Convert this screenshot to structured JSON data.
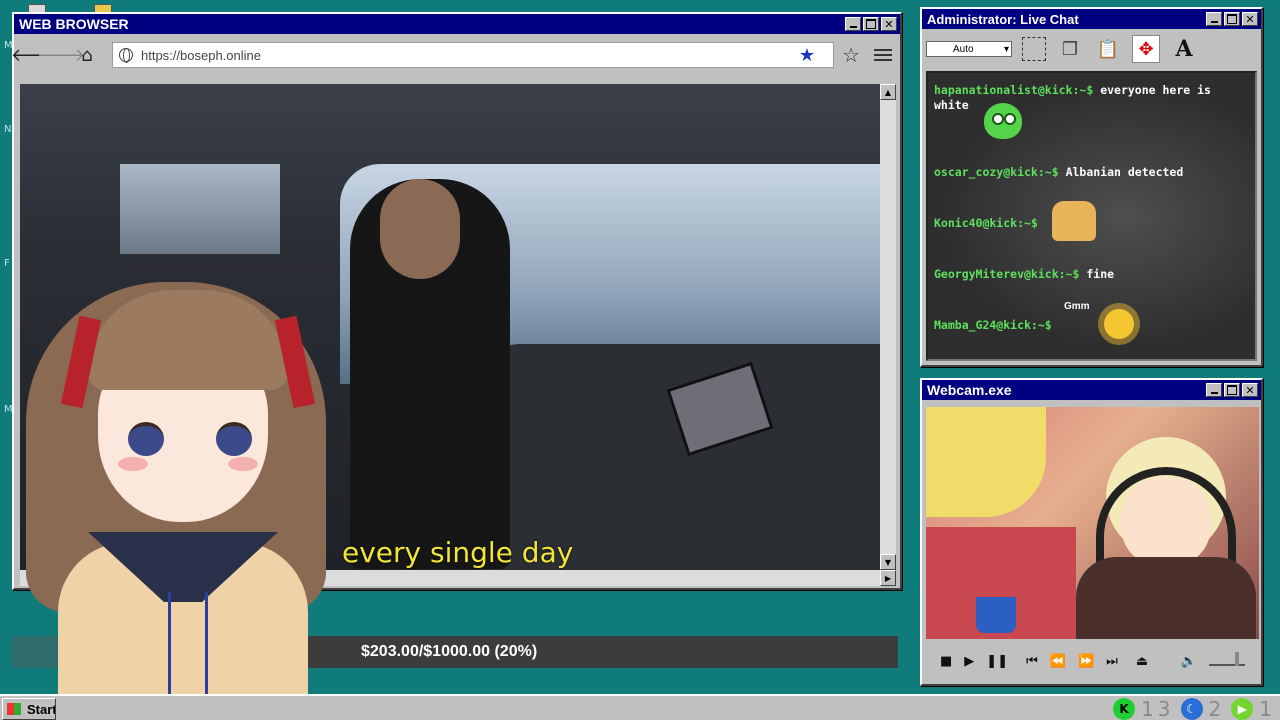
{
  "browser": {
    "title": "WEB BROWSER",
    "url": "https://boseph.online",
    "video_caption": "every single day"
  },
  "chat": {
    "title": "Administrator: Live Chat",
    "zoom_select": "Auto",
    "messages": [
      {
        "user": "hapanationalist@kick:~$",
        "text": "everyone here is",
        "text2": "white",
        "emote": "green-blob-emote"
      },
      {
        "user": "oscar_cozy@kick:~$",
        "text": "Albanian detected"
      },
      {
        "user": "Konic40@kick:~$",
        "text": "",
        "emote": "eevee-emote"
      },
      {
        "user": "GeorgyMiterev@kick:~$",
        "text": "fine"
      },
      {
        "user": "Mamba_G24@kick:~$",
        "text": "",
        "emote": "sun-emote",
        "emote_label": "Gmm"
      }
    ]
  },
  "webcam": {
    "title": "Webcam.exe"
  },
  "donation": {
    "label": "$203.00/$1000.00 (20%)",
    "raised": 203.0,
    "goal": 1000.0,
    "percent": 20
  },
  "taskbar": {
    "start_label": "Start",
    "tray": [
      {
        "icon": "kick-icon",
        "count": "13"
      },
      {
        "icon": "moon-icon",
        "count": "2"
      },
      {
        "icon": "rumble-icon",
        "count": "1"
      }
    ]
  },
  "colors": {
    "desktop": "#0f7b7b",
    "titlebar": "#000080",
    "chat_user": "#5de05d",
    "caption": "#f2e53a"
  }
}
